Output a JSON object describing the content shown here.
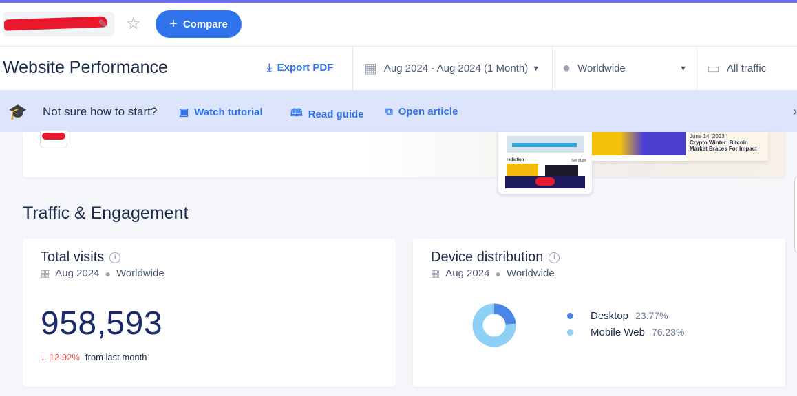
{
  "header": {
    "compare_label": "Compare"
  },
  "title_bar": {
    "title": "Website Performance",
    "export_label": "Export PDF",
    "date_filter": "Aug 2024 - Aug 2024 (1 Month)",
    "geo_filter": "Worldwide",
    "traffic_filter": "All traffic"
  },
  "help_bar": {
    "prompt": "Not sure how to start?",
    "links": [
      "Watch tutorial",
      "Read guide",
      "Open article"
    ]
  },
  "preview": {
    "mobile_heading": "rediction",
    "mobile_more": "See More",
    "desktop_date": "June 14, 2023",
    "desktop_headline": "Crypto Winter: Bitcoin Market Braces For Impact"
  },
  "section": {
    "title": "Traffic & Engagement"
  },
  "visits_card": {
    "title": "Total visits",
    "period": "Aug 2024",
    "region": "Worldwide",
    "value": "958,593",
    "change": "-12.92%",
    "change_suffix": "from last month"
  },
  "device_card": {
    "title": "Device distribution",
    "period": "Aug 2024",
    "region": "Worldwide",
    "series": [
      {
        "label": "Desktop",
        "pct": "23.77%",
        "value": 23.77,
        "color": "#4a86e8"
      },
      {
        "label": "Mobile Web",
        "pct": "76.23%",
        "value": 76.23,
        "color": "#8ed0f7"
      }
    ]
  },
  "colors": {
    "accent": "#2f73ec",
    "negative": "#e8463c",
    "banner_bg": "#dce5fb"
  }
}
